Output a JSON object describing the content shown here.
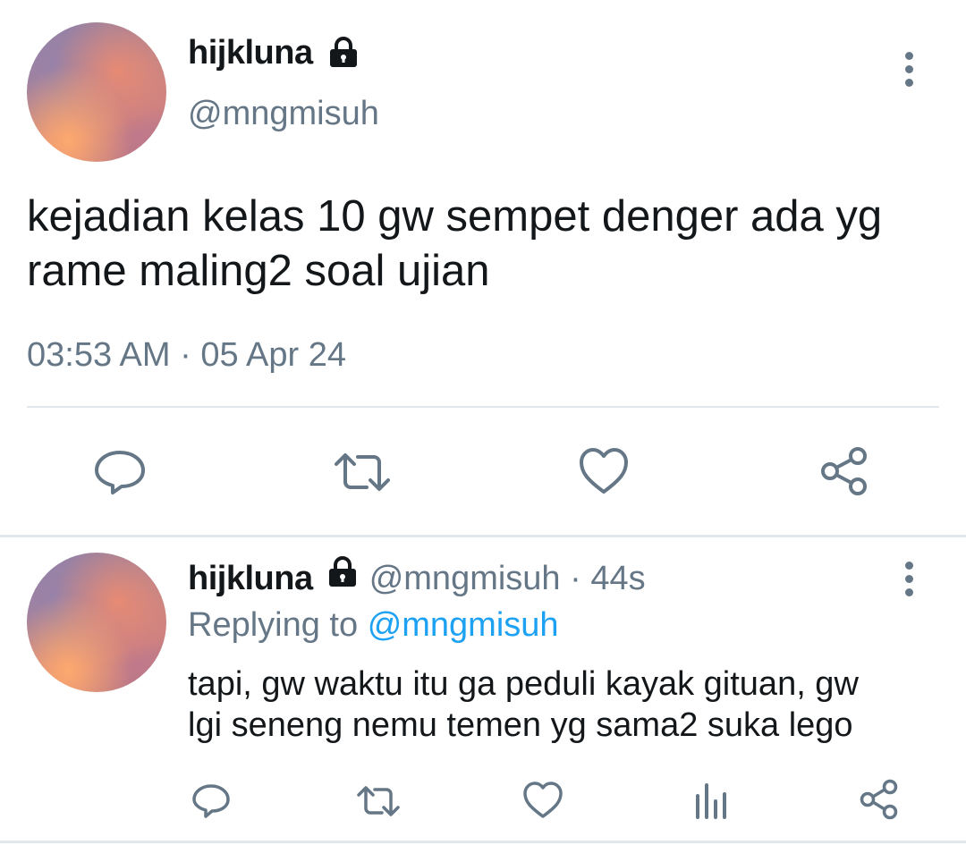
{
  "main_tweet": {
    "display_name": "hijkluna",
    "handle": "@mngmisuh",
    "text_line1": "kejadian kelas 10 gw sempet denger ada yg",
    "text_line2": "rame maling2 soal ujian",
    "timestamp": "03:53 AM · 05 Apr 24",
    "actions": [
      "reply-icon",
      "retweet-icon",
      "like-icon",
      "share-icon"
    ]
  },
  "reply_tweet": {
    "display_name": "hijkluna",
    "handle": "@mngmisuh",
    "age": "· 44s",
    "replying_prefix": "Replying to",
    "replying_handle": "@mngmisuh",
    "text_line1": "tapi, gw waktu itu ga peduli kayak gituan, gw",
    "text_line2": "lgi seneng nemu temen yg sama2 suka lego",
    "actions": [
      "reply-icon",
      "retweet-icon",
      "like-icon",
      "analytics-icon",
      "share-icon"
    ]
  },
  "colors": {
    "text": "#14171a",
    "secondary": "#657786",
    "link": "#1da1f2",
    "divider": "#e1e8ed"
  }
}
